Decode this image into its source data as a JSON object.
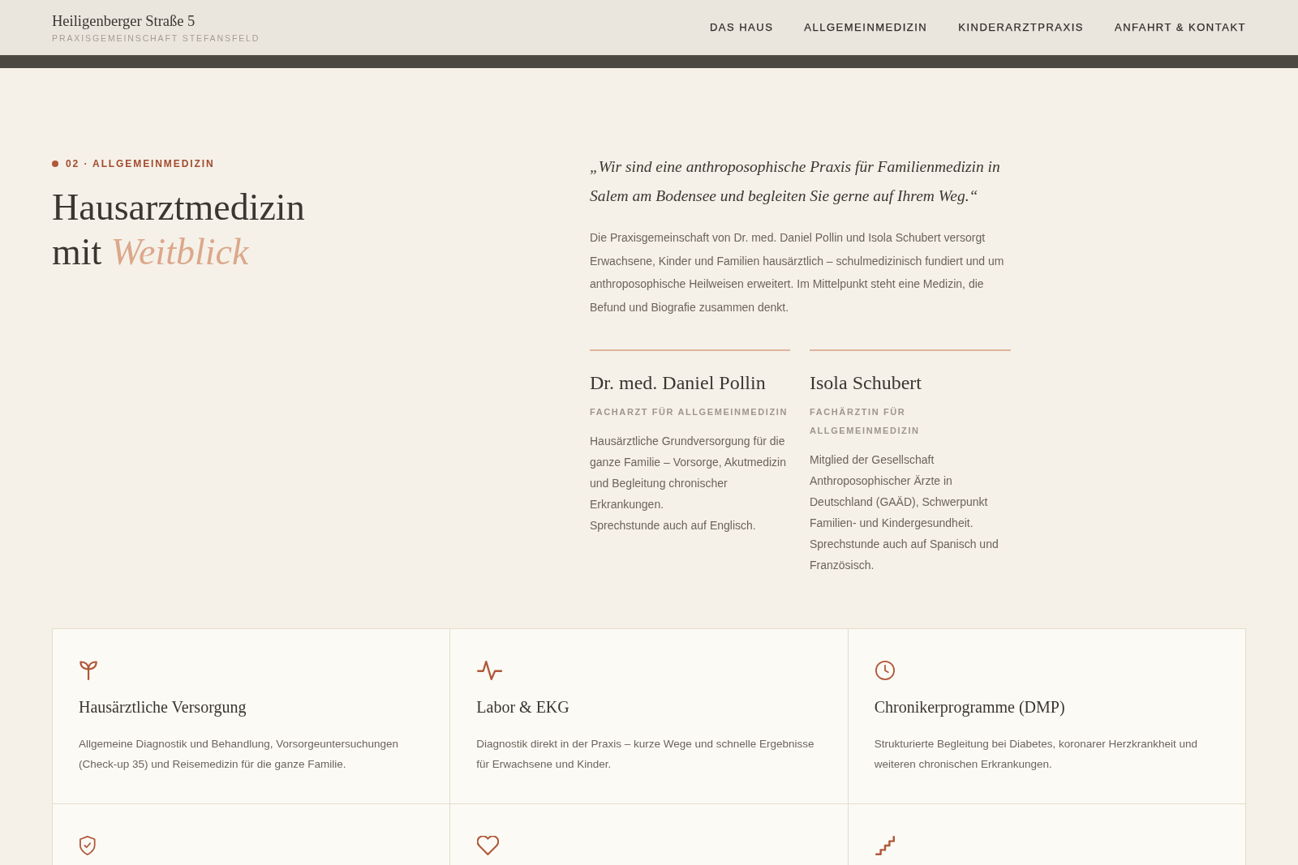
{
  "header": {
    "title": "Heiligenberger Straße 5",
    "subtitle": "PRAXISGEMEINSCHAFT STEFANSFELD",
    "nav": [
      {
        "label": "DAS HAUS"
      },
      {
        "label": "ALLGEMEINMEDIZIN"
      },
      {
        "label": "KINDERARZTPRAXIS"
      },
      {
        "label": "ANFAHRT & KONTAKT"
      }
    ]
  },
  "intro": {
    "eyebrow": "02 · ALLGEMEINMEDIZIN",
    "heading": "Hausarztmedizin mit *Weitblick*",
    "quote": "„Wir sind eine anthroposophische Praxis für Familienmedizin in Salem am Bodensee und begleiten Sie gerne auf Ihrem Weg.“",
    "text": "Die Praxisgemeinschaft von Dr. med. Daniel Pollin und Isola Schubert versorgt Erwachsene, Kinder und Familien hausärztlich – schulmedizinisch fundiert und um anthroposophische Heilweisen erweitert. Im Mittelpunkt steht eine Medizin, die Befund und Biografie zusammen denkt.",
    "doctors": [
      {
        "name": "Dr. med. Daniel Pollin",
        "role": "FACHARZT FÜR ALLGEMEINMEDIZIN",
        "bio": "Hausärztliche Grundversorgung für die ganze Familie – Vorsorge, Akutmedizin und Begleitung chronischer Erkrankungen.\nSprechstunde auch auf Englisch."
      },
      {
        "name": "Isola Schubert",
        "role": "FACHÄRZTIN FÜR ALLGEMEINMEDIZIN",
        "bio": "Mitglied der Gesellschaft Anthroposophischer Ärzte in Deutschland (GAÄD), Schwerpunkt Familien- und Kindergesundheit.\nSprechstunde auch auf Spanisch und Französisch."
      }
    ]
  },
  "services": [
    {
      "title": "Hausärztliche Versorgung",
      "text": "Allgemeine Diagnostik und Behandlung, Vorsorgeuntersuchungen (Check-up 35) und Reisemedizin für die ganze Familie."
    },
    {
      "title": "Labor & EKG",
      "text": "Diagnostik direkt in der Praxis – kurze Wege und schnelle Ergebnisse für Erwachsene und Kinder."
    },
    {
      "title": "Chronikerprogramme (DMP)",
      "text": "Strukturierte Begleitung bei Diabetes, koronarer Herzkrankheit und weiteren chronischen Erkrankungen."
    }
  ]
}
